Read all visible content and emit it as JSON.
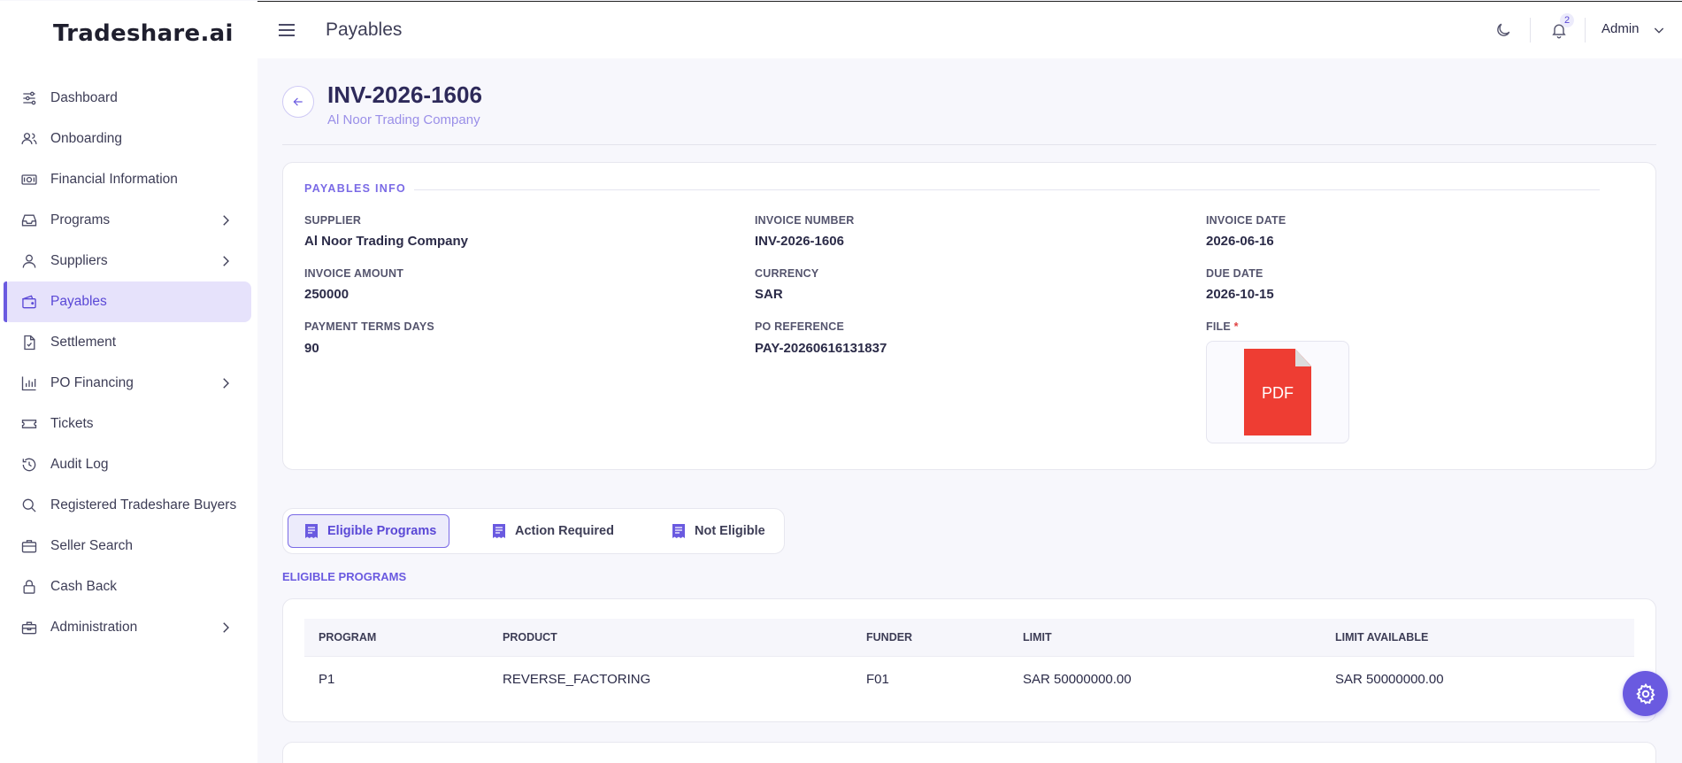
{
  "app": {
    "logo": "Tradeshare.ai"
  },
  "topbar": {
    "title": "Payables",
    "notification_count": "2",
    "user": "Admin"
  },
  "sidebar": {
    "items": [
      {
        "label": "Dashboard",
        "icon": "sliders-icon",
        "has_children": false
      },
      {
        "label": "Onboarding",
        "icon": "users-icon",
        "has_children": false
      },
      {
        "label": "Financial Information",
        "icon": "cash-icon",
        "has_children": false
      },
      {
        "label": "Programs",
        "icon": "inbox-icon",
        "has_children": true
      },
      {
        "label": "Suppliers",
        "icon": "user-icon",
        "has_children": true
      },
      {
        "label": "Payables",
        "icon": "wallet-icon",
        "has_children": false,
        "active": true
      },
      {
        "label": "Settlement",
        "icon": "file-check-icon",
        "has_children": false
      },
      {
        "label": "PO Financing",
        "icon": "bar-chart-icon",
        "has_children": true
      },
      {
        "label": "Tickets",
        "icon": "ticket-icon",
        "has_children": false
      },
      {
        "label": "Audit Log",
        "icon": "history-icon",
        "has_children": false
      },
      {
        "label": "Registered Tradeshare Buyers",
        "icon": "search-icon",
        "has_children": false
      },
      {
        "label": "Seller Search",
        "icon": "briefcase-icon",
        "has_children": false
      },
      {
        "label": "Cash Back",
        "icon": "lock-icon",
        "has_children": false
      },
      {
        "label": "Administration",
        "icon": "toolbox-icon",
        "has_children": true
      }
    ]
  },
  "header": {
    "invoice_title": "INV-2026-1606",
    "company": "Al Noor Trading Company"
  },
  "payables_info": {
    "section_title": "PAYABLES INFO",
    "supplier_label": "SUPPLIER",
    "supplier_value": "Al Noor Trading Company",
    "invoice_number_label": "INVOICE NUMBER",
    "invoice_number_value": "INV-2026-1606",
    "invoice_date_label": "INVOICE DATE",
    "invoice_date_value": "2026-06-16",
    "invoice_amount_label": "INVOICE AMOUNT",
    "invoice_amount_value": "250000",
    "currency_label": "CURRENCY",
    "currency_value": "SAR",
    "due_date_label": "DUE DATE",
    "due_date_value": "2026-10-15",
    "payment_terms_label": "PAYMENT TERMS DAYS",
    "payment_terms_value": "90",
    "po_reference_label": "PO REFERENCE",
    "po_reference_value": "PAY-20260616131837",
    "file_label": "FILE",
    "file_required_mark": "*",
    "file_type": "PDF"
  },
  "tabs": [
    {
      "label": "Eligible Programs",
      "active": true
    },
    {
      "label": "Action Required",
      "active": false
    },
    {
      "label": "Not Eligible",
      "active": false
    }
  ],
  "eligible_section_title": "ELIGIBLE PROGRAMS",
  "programs_table": {
    "columns": [
      "PROGRAM",
      "PRODUCT",
      "FUNDER",
      "LIMIT",
      "LIMIT AVAILABLE"
    ],
    "rows": [
      [
        "P1",
        "REVERSE_FACTORING",
        "F01",
        "SAR 50000000.00",
        "SAR 50000000.00"
      ]
    ]
  },
  "colors": {
    "accent": "#6a5ae0",
    "active_bg": "#e6e2fb",
    "pdf_red": "#ee3d33"
  }
}
